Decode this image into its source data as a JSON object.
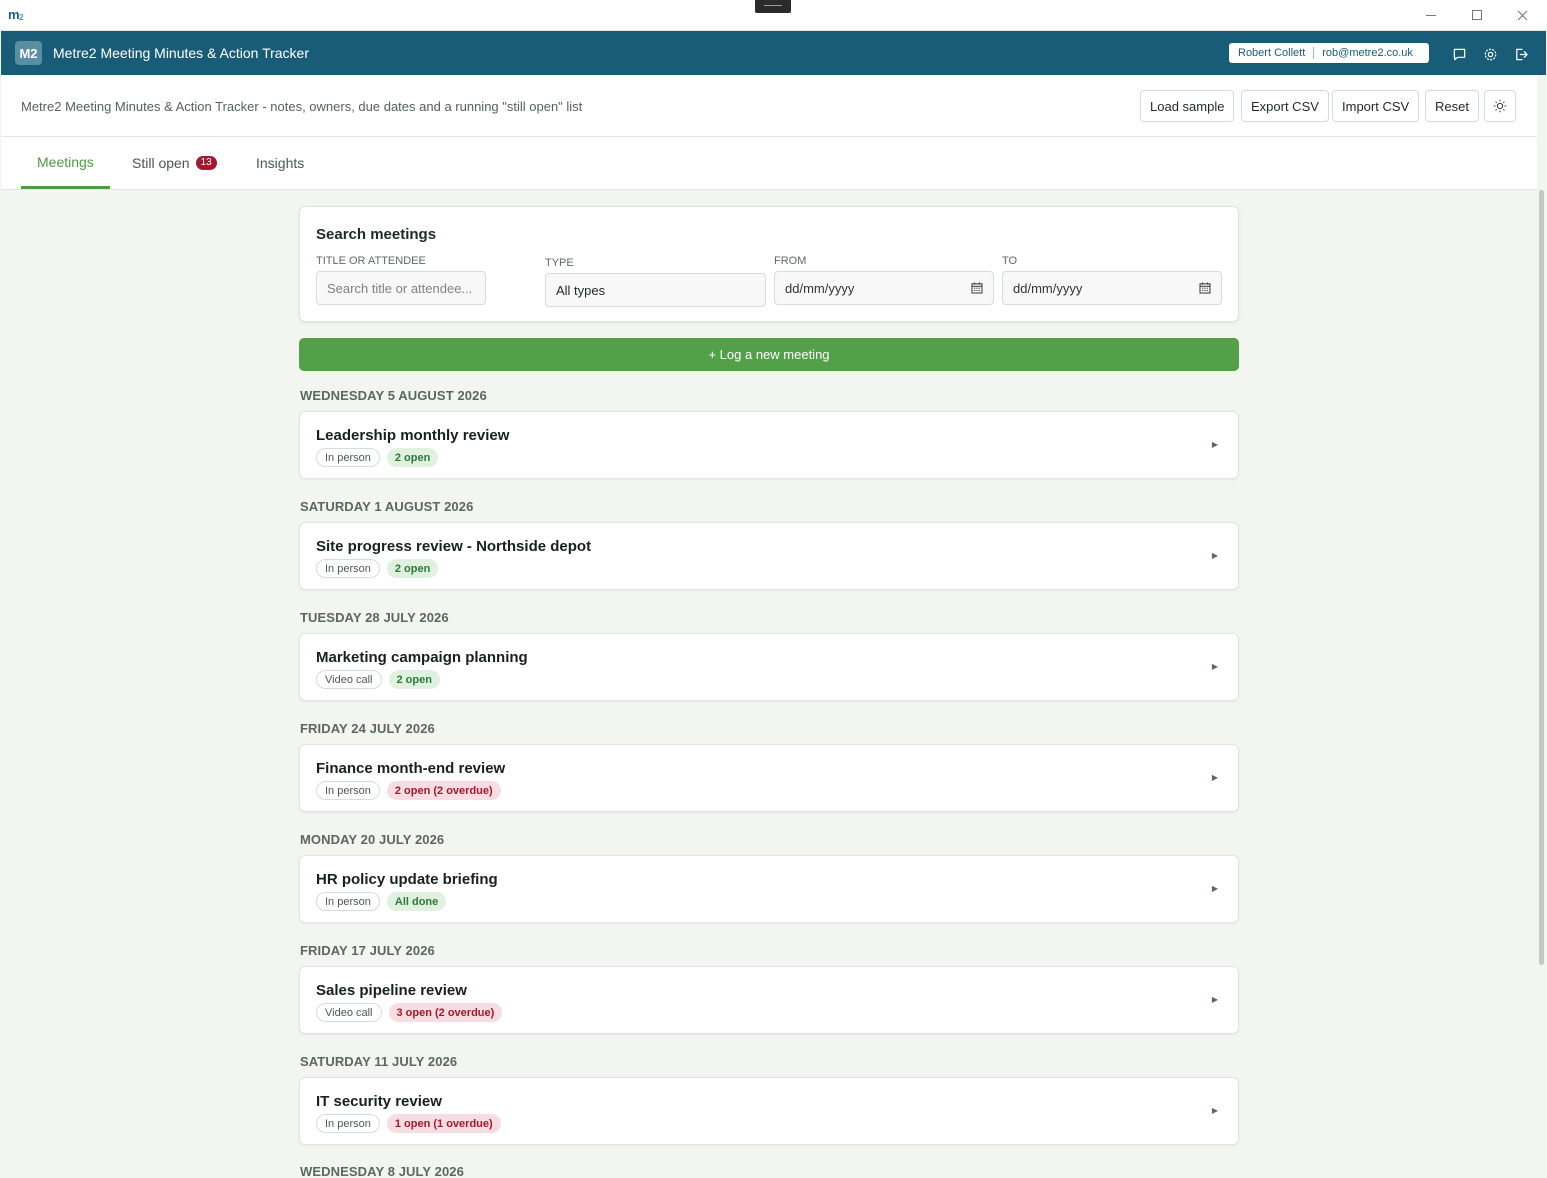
{
  "os_bar": {
    "logo": "m",
    "logo_sub": "2",
    "minimize_icon": "minimize-icon",
    "maximize_icon": "maximize-icon",
    "close_icon": "close-icon"
  },
  "header": {
    "badge": "M2",
    "title": "Metre2 Meeting Minutes & Action Tracker",
    "user_name": "Robert Collett",
    "user_email": "rob@metre2.co.uk",
    "icons": [
      "chat-icon",
      "gear-icon",
      "logout-icon"
    ],
    "color": "#195c78"
  },
  "subheader": {
    "subtitle": "Metre2 Meeting Minutes & Action Tracker - notes, owners, due dates and a running \"still open\" list",
    "buttons": {
      "load_sample": "Load sample",
      "export_csv": "Export CSV",
      "import_csv": "Import CSV",
      "reset": "Reset"
    },
    "theme_icon": "sun-icon"
  },
  "tabs": {
    "meetings": "Meetings",
    "still_open": "Still open",
    "still_open_count": "13",
    "insights": "Insights",
    "accent": "#4f9b45"
  },
  "search": {
    "heading": "Search meetings",
    "title_label": "TITLE OR ATTENDEE",
    "title_placeholder": "Search title or attendee...",
    "type_label": "TYPE",
    "type_value": "All types",
    "from_label": "FROM",
    "from_value": "dd/mm/yyyy",
    "to_label": "TO",
    "to_value": "dd/mm/yyyy"
  },
  "new_meeting_label": "+ Log a new meeting",
  "meetings": [
    {
      "date": "WEDNESDAY 5 AUGUST 2026",
      "title": "Leadership monthly review",
      "type": "In person",
      "status": "2 open",
      "status_kind": "ok"
    },
    {
      "date": "SATURDAY 1 AUGUST 2026",
      "title": "Site progress review - Northside depot",
      "type": "In person",
      "status": "2 open",
      "status_kind": "ok"
    },
    {
      "date": "TUESDAY 28 JULY 2026",
      "title": "Marketing campaign planning",
      "type": "Video call",
      "status": "2 open",
      "status_kind": "ok"
    },
    {
      "date": "FRIDAY 24 JULY 2026",
      "title": "Finance month-end review",
      "type": "In person",
      "status": "2 open (2 overdue)",
      "status_kind": "overdue"
    },
    {
      "date": "MONDAY 20 JULY 2026",
      "title": "HR policy update briefing",
      "type": "In person",
      "status": "All done",
      "status_kind": "ok"
    },
    {
      "date": "FRIDAY 17 JULY 2026",
      "title": "Sales pipeline review",
      "type": "Video call",
      "status": "3 open (2 overdue)",
      "status_kind": "overdue"
    },
    {
      "date": "SATURDAY 11 JULY 2026",
      "title": "IT security review",
      "type": "In person",
      "status": "1 open (1 overdue)",
      "status_kind": "overdue"
    }
  ],
  "next_date": "WEDNESDAY 8 JULY 2026",
  "expand_icon": "chevron-right-icon"
}
